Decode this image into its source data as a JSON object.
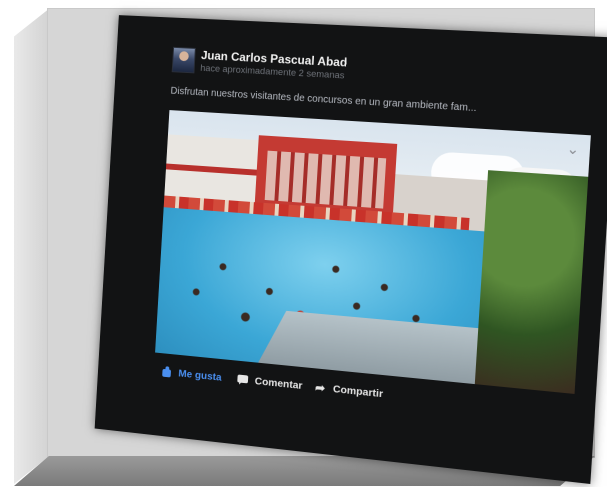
{
  "post": {
    "author": "Juan Carlos Pascual Abad",
    "timestamp": "hace aproximadamente 2 semanas",
    "text": "Disfrutan nuestros visitantes de concursos en un gran ambiente fam...",
    "video": {
      "menu_icon": "chevron-down-icon"
    }
  },
  "actions": {
    "like_label": "Me gusta",
    "comment_label": "Comentar",
    "share_label": "Compartir"
  },
  "colors": {
    "like_accent": "#4a8ff0",
    "screen_bg": "#121314",
    "frame": "#d6d6d6"
  }
}
